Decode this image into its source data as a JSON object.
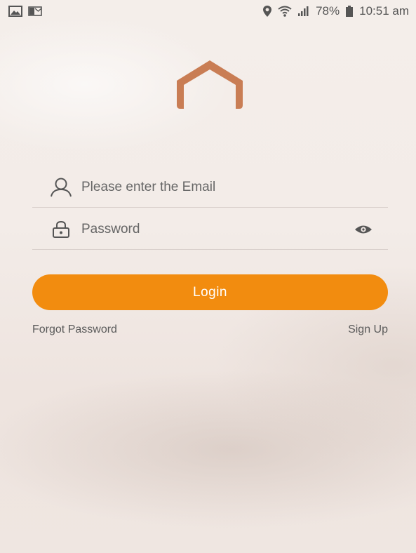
{
  "status_bar": {
    "left_icons": [
      "image-icon",
      "mail-app-icon"
    ],
    "right_icons": [
      "location-icon",
      "wifi-icon",
      "signal-icon"
    ],
    "battery": "78%",
    "time": "10:51 am"
  },
  "logo": {
    "icon": "house-outline-logo",
    "color": "#c97d54"
  },
  "form": {
    "email": {
      "icon": "user-icon",
      "placeholder": "Please enter the Email",
      "value": ""
    },
    "password": {
      "icon": "lock-icon",
      "placeholder": "Password",
      "value": "",
      "toggle_icon": "eye-icon"
    },
    "login_label": "Login"
  },
  "links": {
    "forgot": "Forgot Password",
    "signup": "Sign Up"
  },
  "colors": {
    "accent": "#f28c0f",
    "logo": "#c97d54"
  }
}
